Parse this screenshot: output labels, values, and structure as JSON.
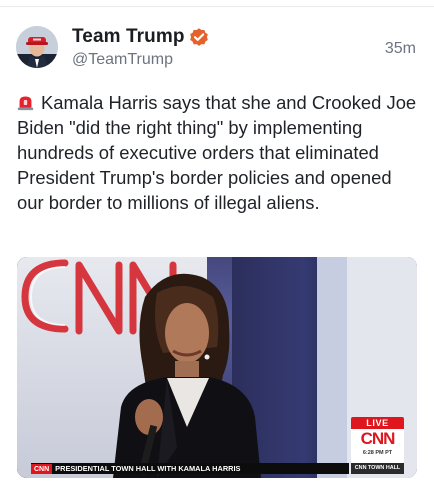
{
  "post": {
    "author_name": "Team Trump",
    "handle": "@TeamTrump",
    "timestamp": "35m",
    "verified": true,
    "text_icon": "police-siren-emoji",
    "text": "Kamala Harris says that she and Crooked Joe Biden \"did the right thing\" by implementing hundreds of executive orders that eliminated President Trump's border policies and opened our border to millions of illegal aliens."
  },
  "media": {
    "background_logo": "CNN",
    "live_label": "LIVE",
    "live_logo": "CNN",
    "live_time": "6:28 PM PT",
    "chyron_chip": "CNN",
    "chyron_text": "PRESIDENTIAL TOWN HALL WITH KAMALA HARRIS",
    "bug_text": "CNN TOWN HALL"
  },
  "colors": {
    "verified_badge": "#e4622b",
    "cnn_red": "#e0161e",
    "handle_gray": "#6b7480",
    "text": "#1f2328"
  }
}
